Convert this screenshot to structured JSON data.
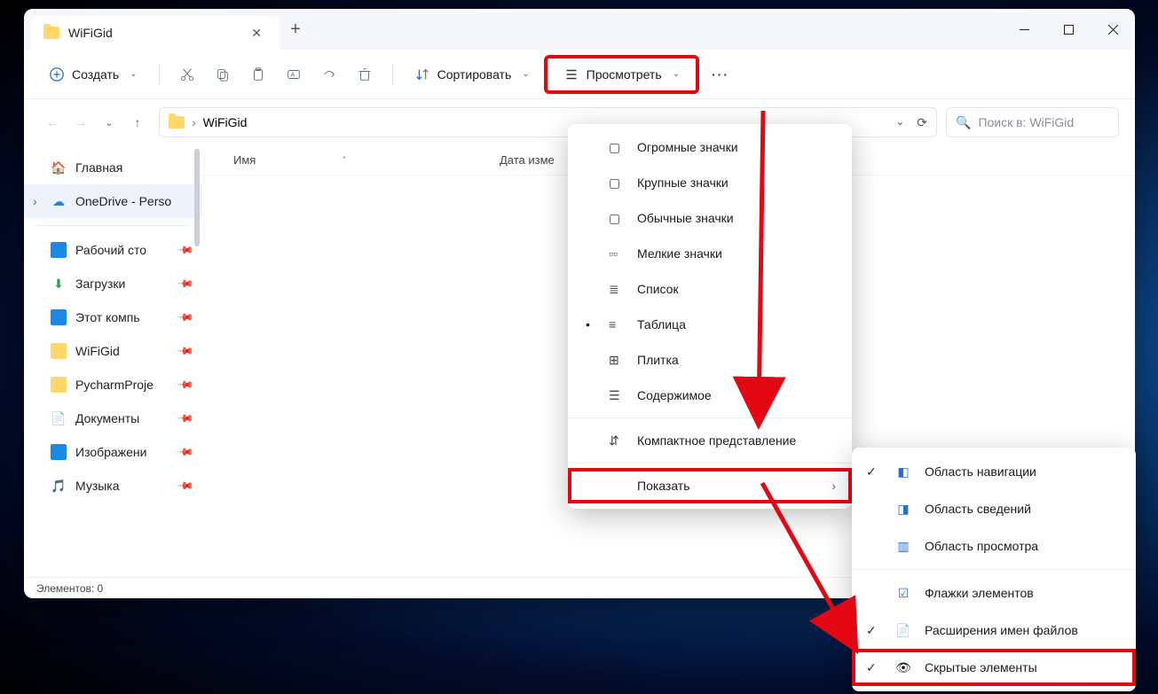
{
  "titlebar": {
    "tab_title": "WiFiGid"
  },
  "toolbar": {
    "new_label": "Создать",
    "sort_label": "Сортировать",
    "view_label": "Просмотреть"
  },
  "addressbar": {
    "path": "WiFiGid"
  },
  "search": {
    "placeholder": "Поиск в: WiFiGid"
  },
  "columns": {
    "name": "Имя",
    "modified": "Дата изме"
  },
  "sidebar": {
    "home": "Главная",
    "onedrive": "OneDrive - Perso",
    "items": [
      "Рабочий сто",
      "Загрузки",
      "Этот компь",
      "WiFiGid",
      "PycharmProje",
      "Документы",
      "Изображени",
      "Музыка"
    ]
  },
  "view_menu": {
    "extra_large": "Огромные значки",
    "large": "Крупные значки",
    "medium": "Обычные значки",
    "small": "Мелкие значки",
    "list": "Список",
    "details": "Таблица",
    "tiles": "Плитка",
    "content": "Содержимое",
    "compact": "Компактное представление",
    "show": "Показать"
  },
  "show_submenu": {
    "nav_pane": "Область навигации",
    "details_pane": "Область сведений",
    "preview_pane": "Область просмотра",
    "item_checkboxes": "Флажки элементов",
    "file_ext": "Расширения имен файлов",
    "hidden": "Скрытые элементы"
  },
  "statusbar": {
    "count": "Элементов: 0"
  }
}
